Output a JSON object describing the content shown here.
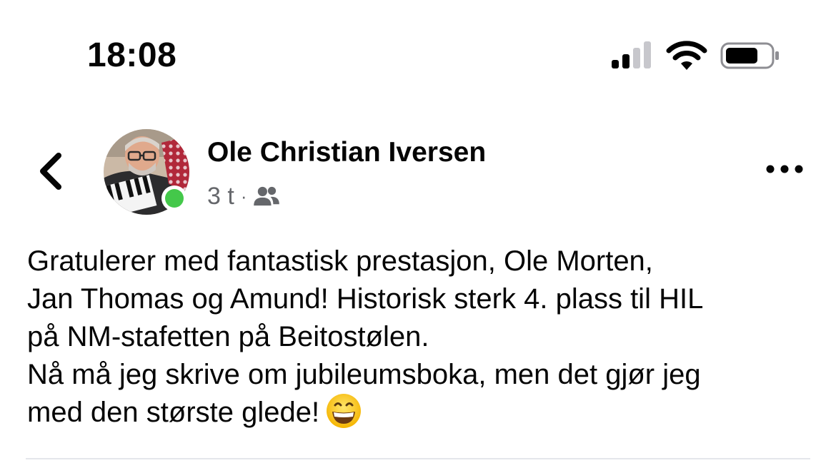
{
  "status_bar": {
    "time": "18:08",
    "icons": [
      "cellular-signal-icon",
      "wifi-icon",
      "battery-icon"
    ]
  },
  "post": {
    "author_name": "Ole Christian Iversen",
    "timestamp": "3 t",
    "separator": "·",
    "audience_icon": "friends-icon",
    "online_indicator_color": "#44c84a",
    "text_lines": [
      "Gratulerer med fantastisk prestasjon, Ole Morten,",
      "Jan Thomas og Amund! Historisk sterk 4. plass til HIL",
      "på NM-stafetten på Beitostølen.",
      "Nå må jeg skrive om jubileumsboka, men det gjør jeg",
      "med den største glede!"
    ],
    "trailing_emoji": "grinning-face-emoji"
  },
  "colors": {
    "text_primary": "#050505",
    "text_secondary": "#65676b",
    "divider": "#e4e6eb",
    "online": "#44c84a"
  }
}
